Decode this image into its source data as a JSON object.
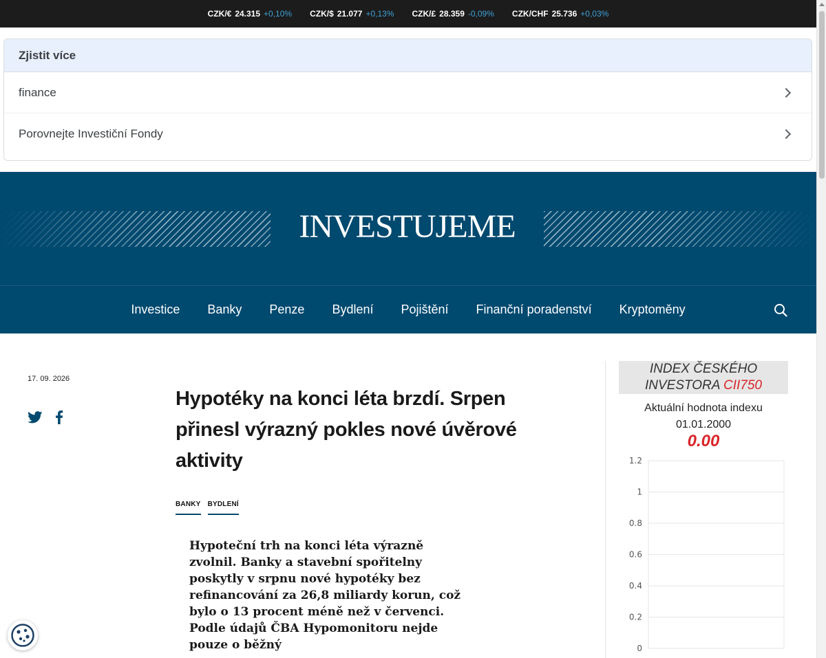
{
  "ticker": [
    {
      "pair": "CZK/€",
      "value": "24.315",
      "change": "+0,10%"
    },
    {
      "pair": "CZK/$",
      "value": "21.077",
      "change": "+0,13%"
    },
    {
      "pair": "CZK/£",
      "value": "28.359",
      "change": "-0,09%"
    },
    {
      "pair": "CZK/CHF",
      "value": "25.736",
      "change": "+0,03%"
    }
  ],
  "ad": {
    "heading": "Zjistit více",
    "items": [
      "finance",
      "Porovnejte Investiční Fondy"
    ]
  },
  "header": {
    "logo": "INVESTUJEME"
  },
  "nav": {
    "items": [
      "Investice",
      "Banky",
      "Penze",
      "Bydlení",
      "Pojištění",
      "Finanční poradenství",
      "Kryptoměny"
    ],
    "search_icon": "search-icon"
  },
  "article": {
    "date": "17. 09. 2026",
    "title": "Hypotéky na konci léta brzdí. Srpen přinesl výrazný pokles nové úvěrové aktivity",
    "tags": [
      "BANKY",
      "BYDLENÍ"
    ],
    "lead": "Hypoteční trh na konci léta výrazně zvolnil. Banky a stavební spořitelny poskytly v srpnu nové hypotéky bez refinancování za 26,8 miliardy korun, což bylo o 13 procent méně než v červenci. Podle údajů ČBA Hypomonitoru nejde pouze o běžný"
  },
  "share": {
    "icons": [
      "twitter-icon",
      "facebook-icon"
    ]
  },
  "index_widget": {
    "title": "INDEX ČESKÉHO INVESTORA",
    "code": "CII750",
    "label": "Aktuální hodnota indexu",
    "date": "01.01.2000",
    "value": "0.00"
  },
  "chart_data": {
    "type": "line",
    "title": "",
    "xlabel": "",
    "ylabel": "",
    "ylim": [
      0,
      1.2
    ],
    "yticks": [
      "1.2",
      "1",
      "0.8",
      "0.6",
      "0.4",
      "0.2",
      "0"
    ],
    "series": [],
    "grid": true
  },
  "colors": {
    "brand": "#00496f",
    "accent": "#d9252a",
    "ticker_change": "#3fa1d9"
  }
}
